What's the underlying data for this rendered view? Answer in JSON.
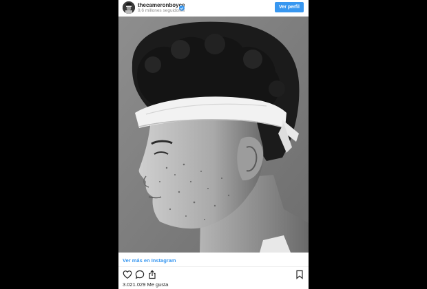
{
  "post": {
    "username": "thecameronboyce",
    "followers": "9,6 millones seguidores",
    "view_profile_label": "Ver perfil",
    "view_more_label": "Ver más en Instagram",
    "likes_text": "3.021.029 Me gusta"
  },
  "icons": {
    "verified": "verified-badge-icon",
    "like": "heart-icon",
    "comment": "comment-bubble-icon",
    "share": "share-upload-icon",
    "save": "bookmark-icon"
  },
  "colors": {
    "accent": "#3897f0",
    "background": "#000000",
    "card": "#ffffff",
    "text": "#262626",
    "muted": "#8e8e8e"
  }
}
